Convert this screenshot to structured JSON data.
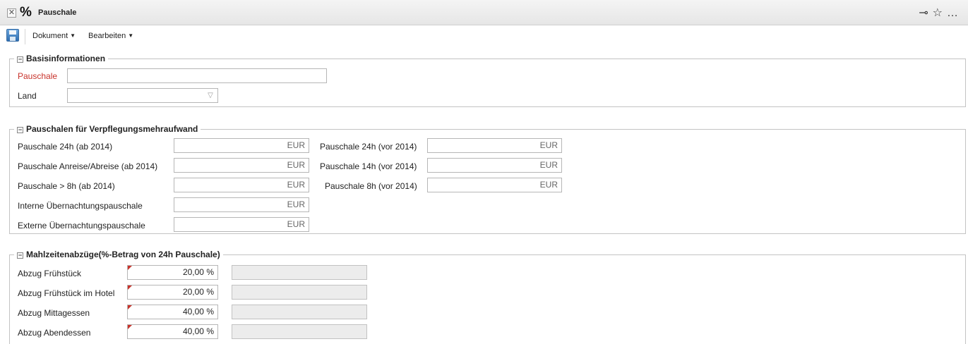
{
  "window": {
    "title": "Pauschale"
  },
  "menubar": {
    "items": [
      {
        "label": "Dokument"
      },
      {
        "label": "Bearbeiten"
      }
    ]
  },
  "section_basis": {
    "legend": "Basisinformationen",
    "pauschale_label": "Pauschale",
    "pauschale_value": "",
    "land_label": "Land",
    "land_value": ""
  },
  "section_verpflegung": {
    "legend": "Pauschalen für Verpflegungsmehraufwand",
    "left": [
      {
        "label": "Pauschale 24h (ab 2014)",
        "value": "",
        "unit": "EUR"
      },
      {
        "label": "Pauschale Anreise/Abreise (ab 2014)",
        "value": "",
        "unit": "EUR"
      },
      {
        "label": "Pauschale > 8h (ab 2014)",
        "value": "",
        "unit": "EUR"
      },
      {
        "label": "Interne Übernachtungspauschale",
        "value": "",
        "unit": "EUR"
      },
      {
        "label": "Externe Übernachtungspauschale",
        "value": "",
        "unit": "EUR"
      }
    ],
    "right": [
      {
        "label": "Pauschale 24h (vor 2014)",
        "value": "",
        "unit": "EUR"
      },
      {
        "label": "Pauschale 14h (vor 2014)",
        "value": "",
        "unit": "EUR"
      },
      {
        "label": "Pauschale 8h (vor 2014)",
        "value": "",
        "unit": "EUR"
      }
    ]
  },
  "section_mahlzeiten": {
    "legend": "Mahlzeitenabzüge(%-Betrag von 24h Pauschale)",
    "rows": [
      {
        "label": "Abzug Frühstück",
        "value": "20,00 %"
      },
      {
        "label": "Abzug Frühstück im Hotel",
        "value": "20,00 %"
      },
      {
        "label": "Abzug Mittagessen",
        "value": "40,00 %"
      },
      {
        "label": "Abzug Abendessen",
        "value": "40,00 %"
      }
    ]
  },
  "colors": {
    "required_label": "#c8332b",
    "border": "#b6b6b6",
    "disabled_bg": "#ececec"
  },
  "icons": [
    "close-icon",
    "percent-icon",
    "key-icon",
    "star-icon",
    "more-icon",
    "save-icon",
    "collapse-icon",
    "combo-arrow-icon"
  ]
}
